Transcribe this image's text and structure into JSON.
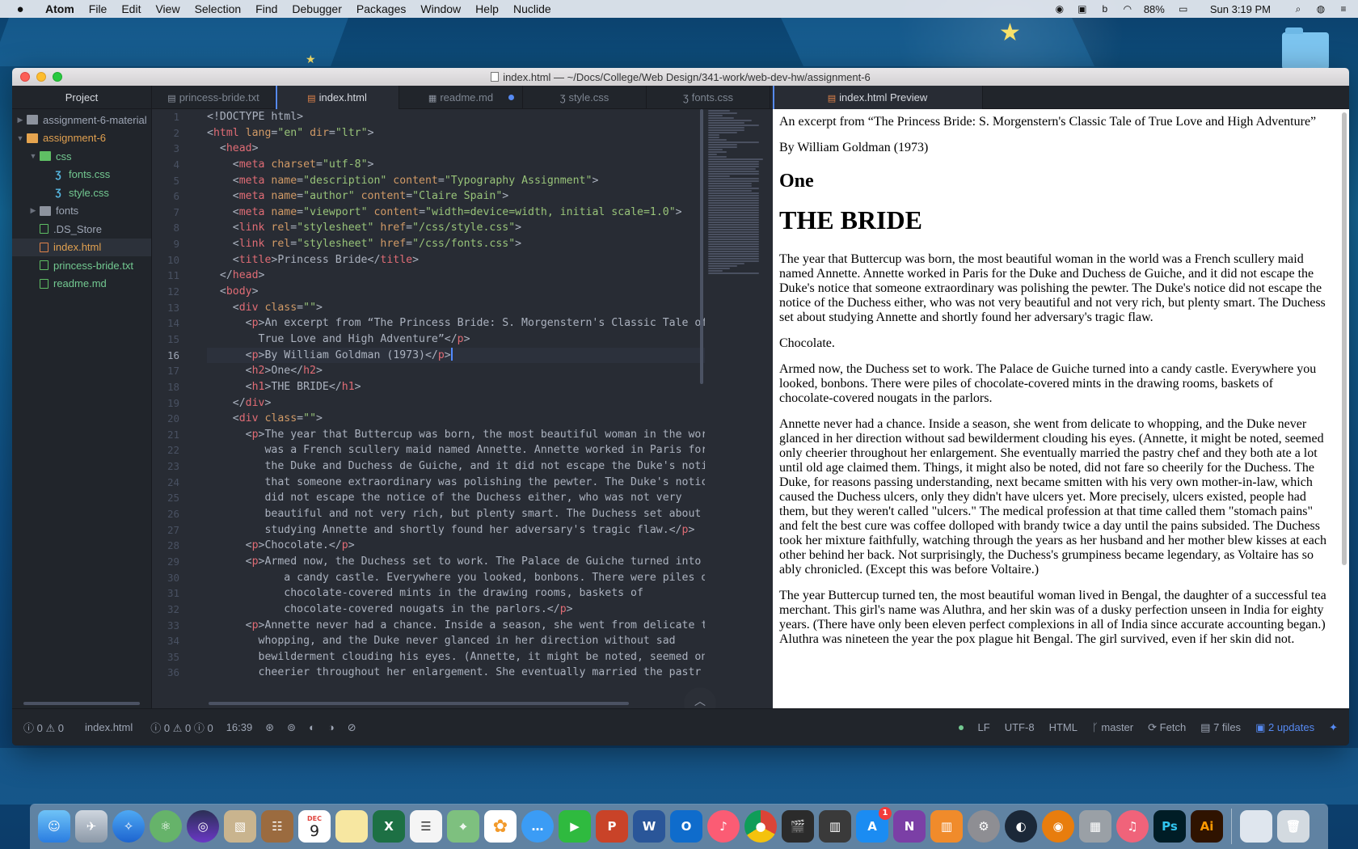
{
  "menubar": {
    "apple": "",
    "items": [
      "Atom",
      "File",
      "Edit",
      "View",
      "Selection",
      "Find",
      "Debugger",
      "Packages",
      "Window",
      "Help",
      "Nuclide"
    ],
    "battery": "88%",
    "clock": "Sun 3:19 PM"
  },
  "window": {
    "title": "index.html — ~/Docs/College/Web Design/341-work/web-dev-hw/assignment-6"
  },
  "tree": {
    "header": "Project",
    "items": [
      {
        "label": "assignment-6-material",
        "type": "folder",
        "expanded": false
      },
      {
        "label": "assignment-6",
        "type": "folder",
        "expanded": true
      },
      {
        "label": "css",
        "type": "folder",
        "expanded": true
      },
      {
        "label": "fonts.css",
        "type": "css"
      },
      {
        "label": "style.css",
        "type": "css"
      },
      {
        "label": "fonts",
        "type": "folder",
        "expanded": false
      },
      {
        "label": ".DS_Store",
        "type": "file"
      },
      {
        "label": "index.html",
        "type": "html"
      },
      {
        "label": "princess-bride.txt",
        "type": "txt"
      },
      {
        "label": "readme.md",
        "type": "md"
      }
    ]
  },
  "tabs": [
    {
      "label": "princess-bride.txt",
      "icon": "file-text-icon"
    },
    {
      "label": "index.html",
      "icon": "file-code-icon"
    },
    {
      "label": "readme.md",
      "icon": "book-icon"
    },
    {
      "label": "style.css",
      "icon": "css-icon"
    },
    {
      "label": "fonts.css",
      "icon": "css-icon"
    }
  ],
  "preview_tab": {
    "label": "index.html Preview"
  },
  "editor": {
    "line_numbers": [
      "1",
      "2",
      "3",
      "4",
      "5",
      "6",
      "7",
      "8",
      "9",
      "10",
      "11",
      "12",
      "13",
      "14",
      "15",
      "16",
      "17",
      "18",
      "19",
      "20",
      "21",
      "22",
      "23",
      "24",
      "25",
      "26",
      "27",
      "28",
      "29",
      "30",
      "31",
      "32",
      "33",
      "34",
      "35",
      "36"
    ],
    "current_line": "16"
  },
  "preview": {
    "p1": "An excerpt from “The Princess Bride: S. Morgenstern's Classic Tale of True Love and High Adventure”",
    "p2": "By William Goldman (1973)",
    "h2": "One",
    "h1": "THE BRIDE",
    "p3": "The year that Buttercup was born, the most beautiful woman in the world was a French scullery maid named Annette. Annette worked in Paris for the Duke and Duchess de Guiche, and it did not escape the Duke's notice that someone extraordinary was polishing the pewter. The Duke's notice did not escape the notice of the Duchess either, who was not very beautiful and not very rich, but plenty smart. The Duchess set about studying Annette and shortly found her adversary's tragic flaw.",
    "p4": "Chocolate.",
    "p5": "Armed now, the Duchess set to work. The Palace de Guiche turned into a candy castle. Everywhere you looked, bonbons. There were piles of chocolate-covered mints in the drawing rooms, baskets of chocolate-covered nougats in the parlors.",
    "p6": "Annette never had a chance. Inside a season, she went from delicate to whopping, and the Duke never glanced in her direction without sad bewilderment clouding his eyes. (Annette, it might be noted, seemed only cheerier throughout her enlargement. She eventually married the pastry chef and they both ate a lot until old age claimed them. Things, it might also be noted, did not fare so cheerily for the Duchess. The Duke, for reasons passing understanding, next became smitten with his very own mother-in-law, which caused the Duchess ulcers, only they didn't have ulcers yet. More precisely, ulcers existed, people had them, but they weren't called \"ulcers.\" The medical profession at that time called them \"stomach pains\" and felt the best cure was coffee dolloped with brandy twice a day until the pains subsided. The Duchess took her mixture faithfully, watching through the years as her husband and her mother blew kisses at each other behind her back. Not surprisingly, the Duchess's grumpiness became legendary, as Voltaire has so ably chronicled. (Except this was before Voltaire.)",
    "p7": "The year Buttercup turned ten, the most beautiful woman lived in Bengal, the daughter of a successful tea merchant. This girl's name was Aluthra, and her skin was of a dusky perfection unseen in India for eighty years. (There have only been eleven perfect complexions in all of India since accurate accounting began.) Aluthra was nineteen the year the pox plague hit Bengal. The girl survived, even if her skin did not."
  },
  "statusbar": {
    "errors": "0",
    "warnings": "0",
    "file": "index.html",
    "diag": "0 ⚠ 0 ⓘ 0",
    "position": "16:39",
    "line_ending": "LF",
    "encoding": "UTF-8",
    "grammar": "HTML",
    "branch": "master",
    "fetch": "Fetch",
    "files": "7 files",
    "updates": "2 updates"
  },
  "dock": {
    "badges": {
      "appstore": "1"
    },
    "calendar_month": "DEC",
    "calendar_day": "9"
  },
  "colors": {
    "editor_bg": "#282c34",
    "sidebar_bg": "#21252b",
    "tag": "#e06c75",
    "attr": "#d19a66",
    "string": "#98c379",
    "accent": "#568af2"
  }
}
